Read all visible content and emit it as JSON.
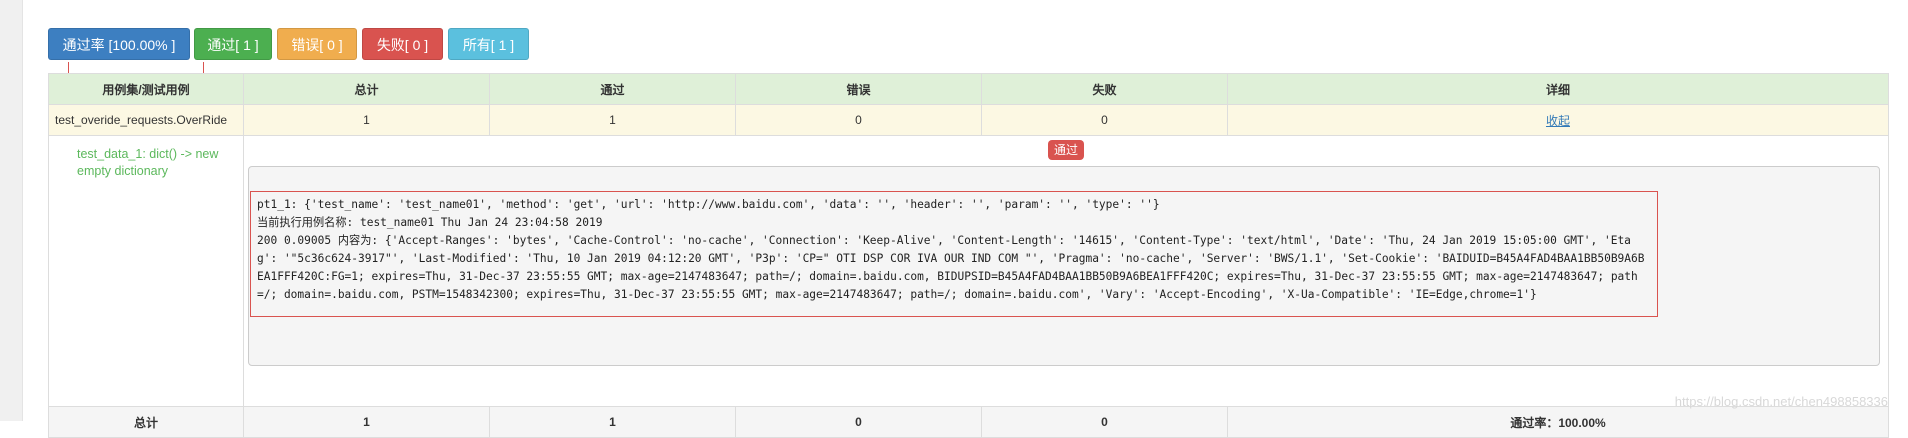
{
  "toolbar": {
    "rate": "通过率 [100.00% ]",
    "pass": "通过[ 1 ]",
    "error": "错误[ 0 ]",
    "fail": "失败[ 0 ]",
    "all": "所有[ 1 ]"
  },
  "table": {
    "headers": [
      "用例集/测试用例",
      "总计",
      "通过",
      "错误",
      "失败",
      "详细"
    ],
    "suite": {
      "name": "test_overide_requests.OverRide",
      "total": "1",
      "pass": "1",
      "error": "0",
      "fail": "0",
      "detail_link": "收起"
    },
    "case": {
      "name": "test_data_1: dict() -> new empty dictionary",
      "status_badge": "通过",
      "log_lines": [
        "pt1_1: {'test_name': 'test_name01', 'method': 'get', 'url': 'http://www.baidu.com', 'data': '', 'header': '', 'param': '', 'type': ''}",
        "当前执行用例名称: test_name01 Thu Jan 24 23:04:58 2019",
        "200 0.09005 内容为: {'Accept-Ranges': 'bytes', 'Cache-Control': 'no-cache', 'Connection': 'Keep-Alive', 'Content-Length': '14615', 'Content-Type': 'text/html', 'Date': 'Thu, 24 Jan 2019 15:05:00 GMT', 'Etag': '\"5c36c624-3917\"', 'Last-Modified': 'Thu, 10 Jan 2019 04:12:20 GMT', 'P3p': 'CP=\" OTI DSP COR IVA OUR IND COM \"', 'Pragma': 'no-cache', 'Server': 'BWS/1.1', 'Set-Cookie': 'BAIDUID=B45A4FAD4BAA1BB50B9A6BEA1FFF420C:FG=1; expires=Thu, 31-Dec-37 23:55:55 GMT; max-age=2147483647; path=/; domain=.baidu.com, BIDUPSID=B45A4FAD4BAA1BB50B9A6BEA1FFF420C; expires=Thu, 31-Dec-37 23:55:55 GMT; max-age=2147483647; path=/; domain=.baidu.com, PSTM=1548342300; expires=Thu, 31-Dec-37 23:55:55 GMT; max-age=2147483647; path=/; domain=.baidu.com', 'Vary': 'Accept-Encoding', 'X-Ua-Compatible': 'IE=Edge,chrome=1'}"
      ]
    },
    "total_row": {
      "label": "总计",
      "total": "1",
      "pass": "1",
      "error": "0",
      "fail": "0",
      "rate": "通过率：100.00%"
    }
  },
  "watermark": "https://blog.csdn.net/chen498858336",
  "colors": {
    "primary": "#3d7fc1",
    "success": "#4caf50",
    "warning": "#f0ad4e",
    "danger": "#d9534f",
    "info": "#5bc0de"
  }
}
